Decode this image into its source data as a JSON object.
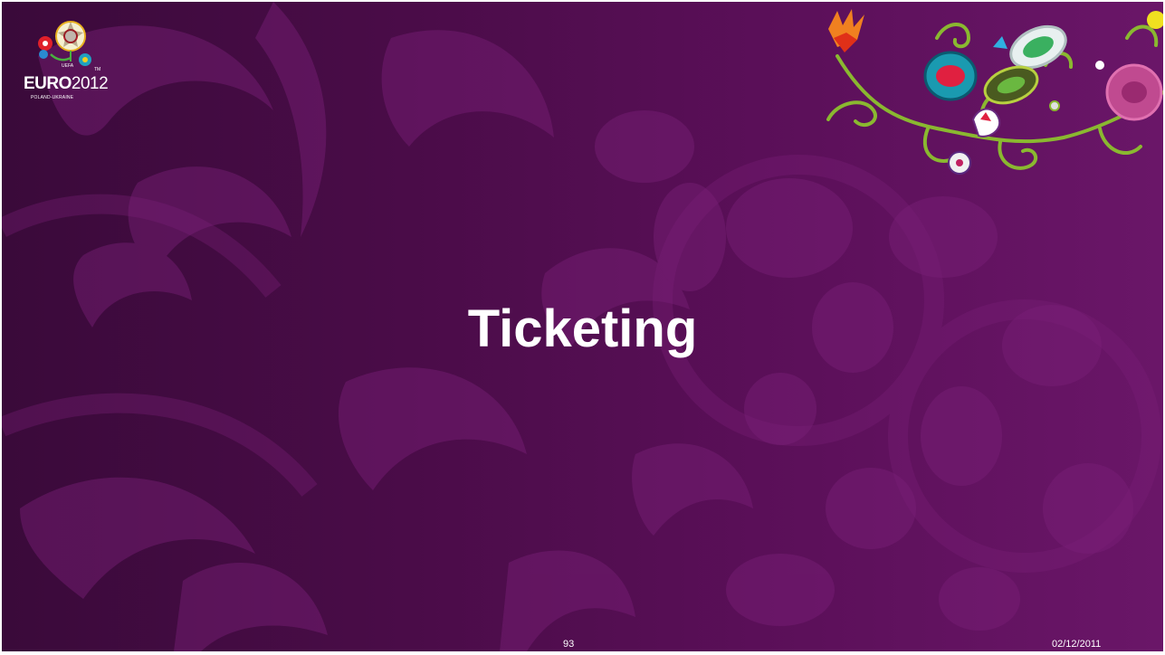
{
  "slide": {
    "title": "Ticketing",
    "page_number": "93",
    "date": "02/12/2011"
  },
  "logo": {
    "brand_bold": "EURO",
    "brand_light": "2012",
    "subtitle": "POLAND-UKRAINE",
    "icon": "euro2012-emblem-icon"
  },
  "decoration": {
    "icon": "floral-stadium-vine-icon"
  },
  "colors": {
    "background_dark": "#3a0a3a",
    "background_light": "#6a1668",
    "pattern": "#7a2078",
    "text": "#ffffff"
  }
}
